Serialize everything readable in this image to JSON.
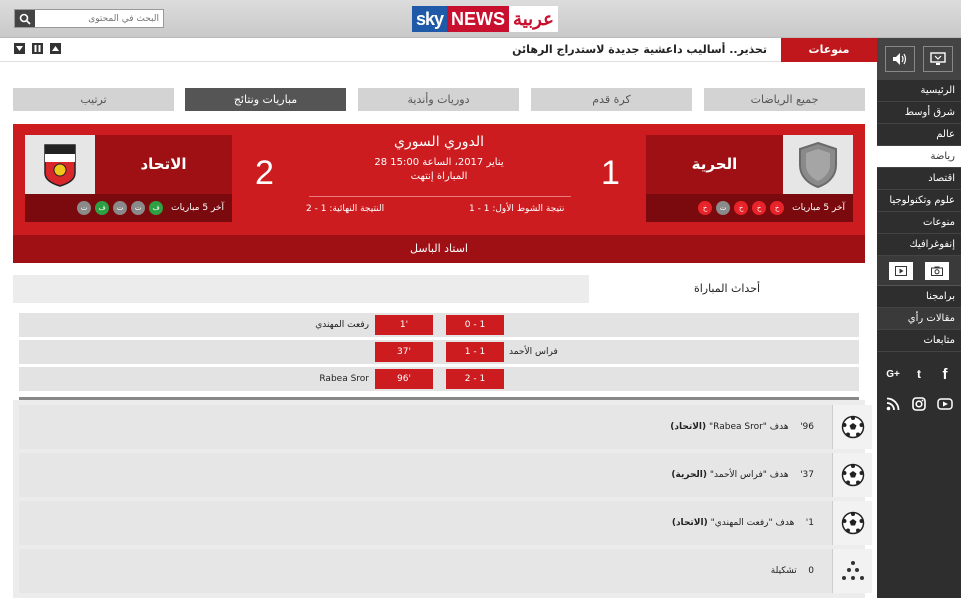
{
  "header": {
    "search_placeholder": "البحث في المحتوى",
    "logo": {
      "sky": "sky",
      "news": "NEWS",
      "arabic": "عربية"
    }
  },
  "ticker": {
    "label": "منوعات",
    "text": "تحذير.. أساليب داعشية جديدة لاستدراج الرهائن"
  },
  "tabs": [
    {
      "label": "جميع الرياضات"
    },
    {
      "label": "كرة قدم"
    },
    {
      "label": "دوريات وأندية"
    },
    {
      "label": "مباريات ونتائج"
    },
    {
      "label": "ترتيب"
    }
  ],
  "match": {
    "league": "الدوري السوري",
    "datetime": "28 يناير 2017، الساعة 15:00",
    "status": "المباراة إنتهت",
    "half_time": "نتيجة الشوط الأول: 1 - 1",
    "full_time": "النتيجة النهائية: 1 - 2",
    "stadium": "استاد الباسل",
    "last5_label": "آخر 5 مباريات",
    "home": {
      "name": "الحرية",
      "score": "1",
      "last5": [
        {
          "r": "l",
          "t": "خ"
        },
        {
          "r": "d",
          "t": "ت"
        },
        {
          "r": "l",
          "t": "خ"
        },
        {
          "r": "l",
          "t": "خ"
        },
        {
          "r": "l",
          "t": "خ"
        }
      ]
    },
    "away": {
      "name": "الاتحاد",
      "score": "2",
      "last5": [
        {
          "r": "d",
          "t": "ت"
        },
        {
          "r": "w",
          "t": "ف"
        },
        {
          "r": "d",
          "t": "ت"
        },
        {
          "r": "d",
          "t": "ت"
        },
        {
          "r": "w",
          "t": "ف"
        }
      ]
    }
  },
  "events_tab": "أحداث المباراة",
  "goals": [
    {
      "score": "0 - 1",
      "minute": "1'",
      "home_scorer": "",
      "away_scorer": "رفعت المهندي"
    },
    {
      "score": "1 - 1",
      "minute": "37'",
      "home_scorer": "فراس الأحمد",
      "away_scorer": ""
    },
    {
      "score": "2 - 1",
      "minute": "96'",
      "home_scorer": "",
      "away_scorer": "Rabea Sror"
    }
  ],
  "events": [
    {
      "minute": "96'",
      "type": "هدف",
      "player": "\"Rabea Sror\"",
      "team": "(الاتحاد)",
      "icon": "ball-icon"
    },
    {
      "minute": "37'",
      "type": "هدف",
      "player": "\"فراس الأحمد\"",
      "team": "(الحرية)",
      "icon": "ball-icon"
    },
    {
      "minute": "1'",
      "type": "هدف",
      "player": "\"رفعت المهندي\"",
      "team": "(الاتحاد)",
      "icon": "ball-icon"
    },
    {
      "minute": "0",
      "type": "تشكيلة",
      "player": "",
      "team": "",
      "icon": "formation-icon"
    }
  ],
  "sidebar": {
    "items": [
      {
        "label": "الرئيسية"
      },
      {
        "label": "شرق أوسط"
      },
      {
        "label": "عالم"
      },
      {
        "label": "رياضة"
      },
      {
        "label": "اقتصاد"
      },
      {
        "label": "علوم وتكنولوجيا"
      },
      {
        "label": "منوعات"
      },
      {
        "label": "إنفوغرافيك"
      }
    ],
    "items2": [
      {
        "label": "برامجنا"
      },
      {
        "label": "مقالات رأي"
      },
      {
        "label": "متابعات"
      }
    ],
    "social": {
      "facebook": "f",
      "twitter": "t",
      "gplus": "G+",
      "youtube": "You",
      "instagram": "ig",
      "rss": "rss"
    }
  },
  "colors": {
    "accent": "#cc1c20",
    "dark": "#9e1014",
    "sidebar": "#2e2e2e"
  }
}
